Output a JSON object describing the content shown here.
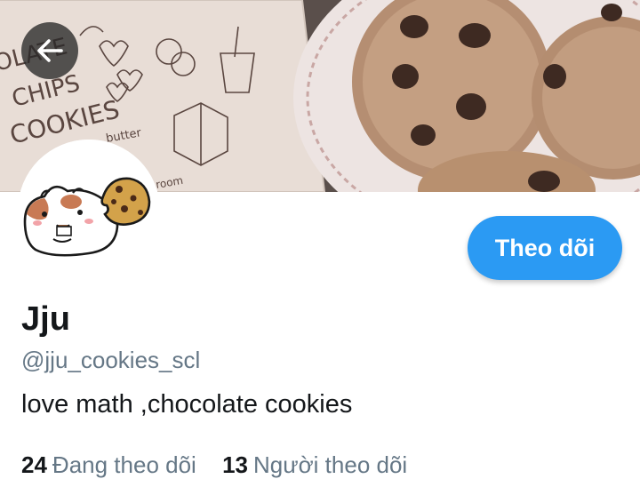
{
  "header": {
    "back_icon": "arrow-left-icon",
    "banner_sketch_text": [
      "OLATE",
      "CHIPS",
      "COOKIES",
      "butter",
      "room"
    ]
  },
  "profile": {
    "display_name": "Jju",
    "handle": "@jju_cookies_scl",
    "bio": "love math ,chocolate cookies",
    "follow_button_label": "Theo dõi"
  },
  "stats": {
    "following_count": "24",
    "following_label": "Đang theo dõi",
    "followers_count": "13",
    "followers_label": "Người theo dõi"
  },
  "colors": {
    "accent": "#2b9af3",
    "text_primary": "#14171a",
    "text_secondary": "#657786"
  }
}
